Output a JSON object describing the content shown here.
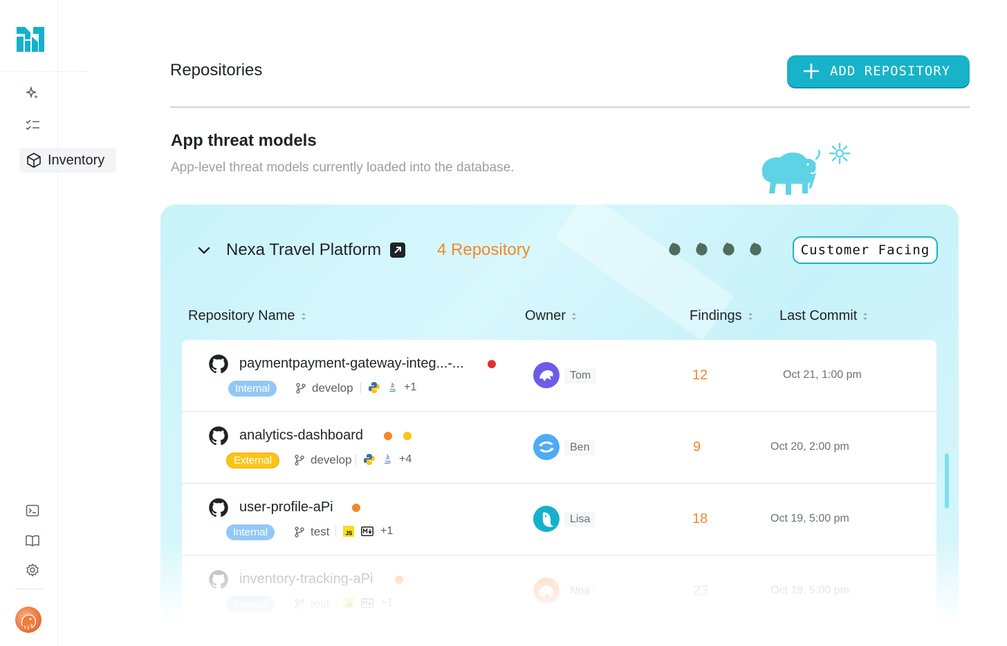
{
  "sidebar": {
    "items": [
      {
        "name": "sparkle",
        "icon": "sparkle-icon"
      },
      {
        "name": "tasks",
        "icon": "checklist-icon"
      },
      {
        "name": "inventory",
        "icon": "cube-icon",
        "label": "Inventory",
        "active": true
      },
      {
        "name": "terminal",
        "icon": "terminal-icon"
      },
      {
        "name": "docs",
        "icon": "book-icon"
      },
      {
        "name": "settings",
        "icon": "gear-icon"
      }
    ]
  },
  "header": {
    "title": "Repositories",
    "add_button_label": "ADD REPOSITORY"
  },
  "section": {
    "title": "App threat models",
    "subtitle": "App-level threat models currently loaded into the database."
  },
  "project": {
    "name": "Nexa Travel Platform",
    "repo_count": "4 Repository",
    "tag": "Customer Facing"
  },
  "table": {
    "columns": {
      "repo": "Repository Name",
      "owner": "Owner",
      "findings": "Findings",
      "last_commit": "Last Commit"
    },
    "rows": [
      {
        "name": "paymentpayment-gateway-integ...-...",
        "visibility": "Internal",
        "branch": "develop",
        "extra_langs": "+1",
        "owner": "Tom",
        "findings": "12",
        "last_commit": "Oct 21, 1:00 pm"
      },
      {
        "name": "analytics-dashboard",
        "visibility": "External",
        "branch": "develop",
        "extra_langs": "+4",
        "owner": "Ben",
        "findings": "9",
        "last_commit": "Oct 20, 2:00 pm"
      },
      {
        "name": "user-profile-aPi",
        "visibility": "Internal",
        "branch": "test",
        "extra_langs": "+1",
        "owner": "Lisa",
        "findings": "18",
        "last_commit": "Oct 19, 5:00 pm"
      },
      {
        "name": "inventory-tracking-aPi",
        "visibility": "Internal",
        "branch": "test",
        "extra_langs": "+1",
        "owner": "Noa",
        "findings": "23",
        "last_commit": "Oct 19, 5:00 pm"
      }
    ]
  },
  "colors": {
    "accent": "#17b3c9",
    "orange": "#f0892c",
    "red_dot": "#e03131",
    "yellow_dot": "#fcc419"
  }
}
